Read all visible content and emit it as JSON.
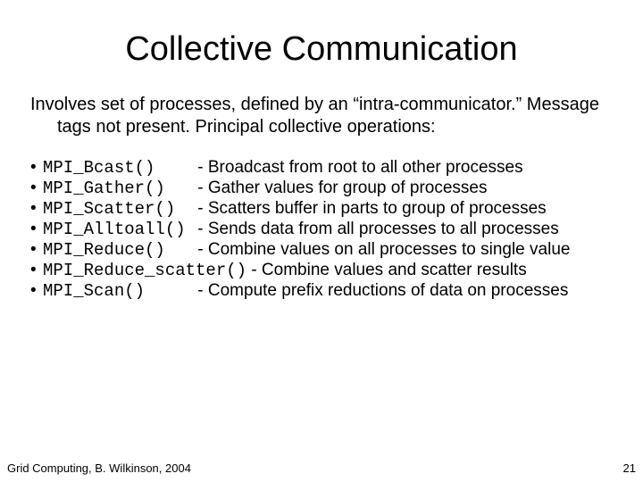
{
  "title": "Collective Communication",
  "intro": "Involves set of processes, defined by an “intra-communicator.” Message tags not present. Principal collective operations:",
  "items": [
    {
      "fn": "MPI_Bcast()",
      "desc": "- Broadcast from root to all other processes",
      "wide": false
    },
    {
      "fn": "MPI_Gather()",
      "desc": "- Gather values for group of processes",
      "wide": false
    },
    {
      "fn": "MPI_Scatter()",
      "desc": "- Scatters buffer in parts to group of processes",
      "wide": false
    },
    {
      "fn": "MPI_Alltoall()",
      "desc": "- Sends data from all processes to all processes",
      "wide": false
    },
    {
      "fn": "MPI_Reduce()",
      "desc": "- Combine values on all processes to single value",
      "wide": false
    },
    {
      "fn": "MPI_Reduce_scatter()",
      "desc": "- Combine values and scatter results",
      "wide": true
    },
    {
      "fn": "MPI_Scan()",
      "desc": "- Compute prefix reductions of data on processes",
      "wide": false
    }
  ],
  "footer_left": "Grid Computing, B. Wilkinson, 2004",
  "footer_right": "21"
}
